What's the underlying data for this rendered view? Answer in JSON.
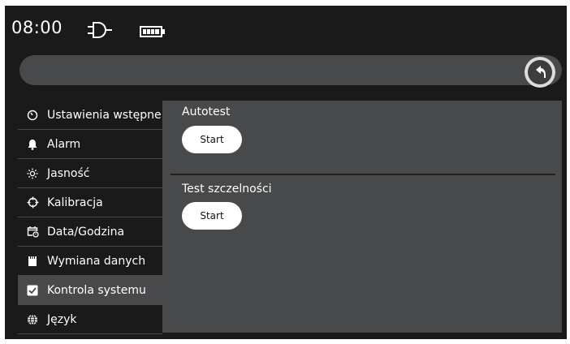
{
  "status": {
    "time": "08:00",
    "plug_icon": "power-plug-icon",
    "battery_icon": "battery-full-icon"
  },
  "header": {
    "title": "",
    "back_icon": "back-arrow-icon"
  },
  "sidebar": {
    "items": [
      {
        "label": "Ustawienia wstępne",
        "icon": "timer-icon",
        "active": false
      },
      {
        "label": "Alarm",
        "icon": "bell-icon",
        "active": false
      },
      {
        "label": "Jasność",
        "icon": "sun-icon",
        "active": false
      },
      {
        "label": "Kalibracja",
        "icon": "crosshair-icon",
        "active": false
      },
      {
        "label": "Data/Godzina",
        "icon": "calendar-clock-icon",
        "active": false
      },
      {
        "label": "Wymiana danych",
        "icon": "sd-card-icon",
        "active": false
      },
      {
        "label": "Kontrola systemu",
        "icon": "checkbox-icon",
        "active": true
      },
      {
        "label": "Język",
        "icon": "globe-icon",
        "active": false
      }
    ]
  },
  "main": {
    "autotest": {
      "label": "Autotest",
      "button": "Start"
    },
    "leak_test": {
      "label": "Test szczelności",
      "button": "Start"
    }
  },
  "colors": {
    "background": "#1a1a1a",
    "panel": "#48494b",
    "button": "#ffffff",
    "text": "#ffffff"
  }
}
